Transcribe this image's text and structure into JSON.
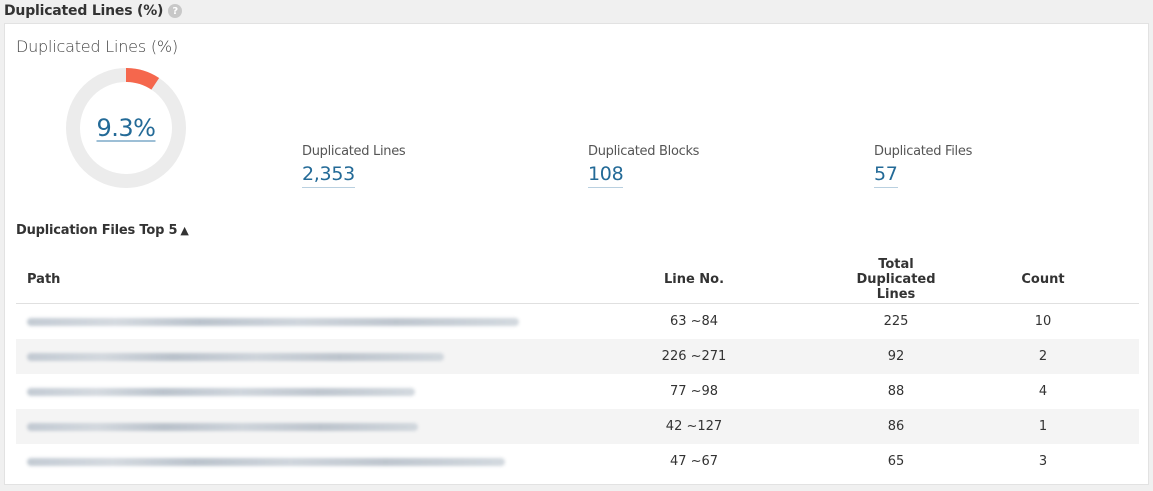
{
  "header": {
    "title": "Duplicated Lines (%)",
    "help_icon": "question-circle-icon"
  },
  "summary": {
    "title": "Duplicated Lines (%)",
    "density_percent": 9.3,
    "density_label": "9.3%",
    "donut_color": "#f5674d",
    "donut_track_color": "#ececec",
    "metrics": [
      {
        "label": "Duplicated Lines",
        "value": "2,353"
      },
      {
        "label": "Duplicated Blocks",
        "value": "108"
      },
      {
        "label": "Duplicated Files",
        "value": "57"
      }
    ]
  },
  "top_files": {
    "title": "Duplication Files Top 5",
    "sort_icon": "triangle-up-icon",
    "sort_glyph": "▲",
    "columns": {
      "path": "Path",
      "line_no": "Line No.",
      "total": "Total Duplicated Lines",
      "count": "Count"
    },
    "rows": [
      {
        "path": "",
        "line_no": "63 ~84",
        "total": "225",
        "count": "10"
      },
      {
        "path": "",
        "line_no": "226 ~271",
        "total": "92",
        "count": "2"
      },
      {
        "path": "",
        "line_no": "77 ~98",
        "total": "88",
        "count": "4"
      },
      {
        "path": "",
        "line_no": "42 ~127",
        "total": "86",
        "count": "1"
      },
      {
        "path": "",
        "line_no": "47 ~67",
        "total": "65",
        "count": "3"
      }
    ]
  }
}
